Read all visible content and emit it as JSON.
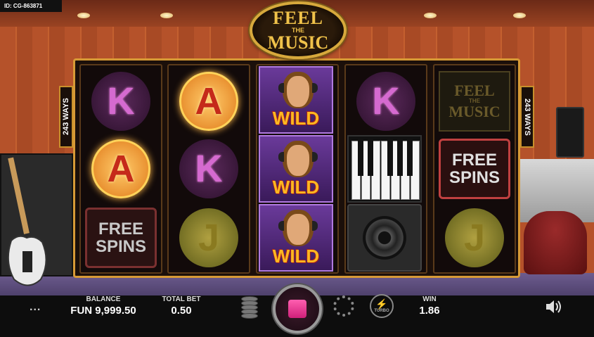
{
  "game_id": "ID: CG-863871",
  "logo": {
    "line1": "FEEL",
    "line2": "THE",
    "line3": "MUSIC"
  },
  "ways": {
    "left": "243 WAYS",
    "right": "243 WAYS"
  },
  "symbols": {
    "k": "K",
    "a": "A",
    "j": "J",
    "free_line1": "FREE",
    "free_line2": "SPINS",
    "wild": "WILD",
    "logo_line1": "FEEL",
    "logo_line2": "THE",
    "logo_line3": "MUSIC"
  },
  "reels": [
    [
      "K",
      "A",
      "FREE SPINS"
    ],
    [
      "A",
      "K",
      "J"
    ],
    [
      "WILD",
      "WILD",
      "WILD"
    ],
    [
      "K",
      "PIANO",
      "SPEAKER"
    ],
    [
      "FEEL THE MUSIC",
      "FREE SPINS",
      "J"
    ]
  ],
  "menu_icon": "...",
  "balance": {
    "label": "BALANCE",
    "value": "FUN 9,999.50"
  },
  "total_bet": {
    "label": "TOTAL BET",
    "value": "0.50"
  },
  "win": {
    "label": "WIN",
    "value": "1.86"
  },
  "turbo_label": "TURBO",
  "icons": {
    "menu": "menu-dots-icon",
    "coins": "coin-stack-icon",
    "spin": "stop-icon",
    "autoplay": "autoplay-icon",
    "turbo": "lightning-icon",
    "sound": "speaker-volume-icon"
  },
  "colors": {
    "frame": "#d79a36",
    "spin_button": "#e0308a",
    "wild_text": "#ffb820",
    "letter_a": "#c52a1a"
  }
}
